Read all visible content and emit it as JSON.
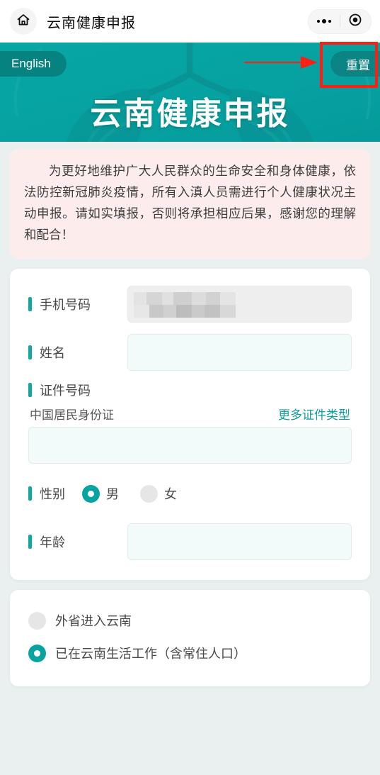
{
  "navbar": {
    "home_icon": "home-icon",
    "title": "云南健康申报",
    "more_icon": "more-dots-icon",
    "capsule_icon": "target-circle-icon"
  },
  "banner": {
    "language_button": "English",
    "reset_button": "重置",
    "title": "云南健康申报",
    "bg_color": "#06a2a1",
    "pill_color": "#0d8484"
  },
  "annotation": {
    "arrow_color": "#fc1f14",
    "box_color": "#fc1f14",
    "arrow_icon": "red-arrow-right-icon"
  },
  "notice": {
    "text": "为更好地维护广大人民群众的生命安全和身体健康，依法防控新冠肺炎疫情，所有入滇人员需进行个人健康状况主动申报。请如实填报，否则将承担相应后果，感谢您的理解和配合！",
    "bg_color": "#fdecec"
  },
  "form": {
    "accent_color": "#12a8a0",
    "fields": [
      {
        "label": "手机号码",
        "value": "",
        "placeholder": "",
        "required": true,
        "disabled": true
      },
      {
        "label": "姓名",
        "value": "",
        "placeholder": "",
        "required": true,
        "disabled": false
      },
      {
        "label": "证件号码",
        "value": "",
        "placeholder": "",
        "required": true,
        "disabled": false
      }
    ],
    "id_type": {
      "current": "中国居民身份证",
      "more_link": "更多证件类型"
    },
    "gender": {
      "label": "性别",
      "options": [
        {
          "label": "男",
          "selected": true
        },
        {
          "label": "女",
          "selected": false
        }
      ]
    },
    "age": {
      "label": "年龄",
      "value": "",
      "placeholder": ""
    }
  },
  "travel_options": {
    "options": [
      {
        "label": "外省进入云南",
        "selected": false
      },
      {
        "label": "已在云南生活工作（含常住人口）",
        "selected": true
      }
    ]
  }
}
